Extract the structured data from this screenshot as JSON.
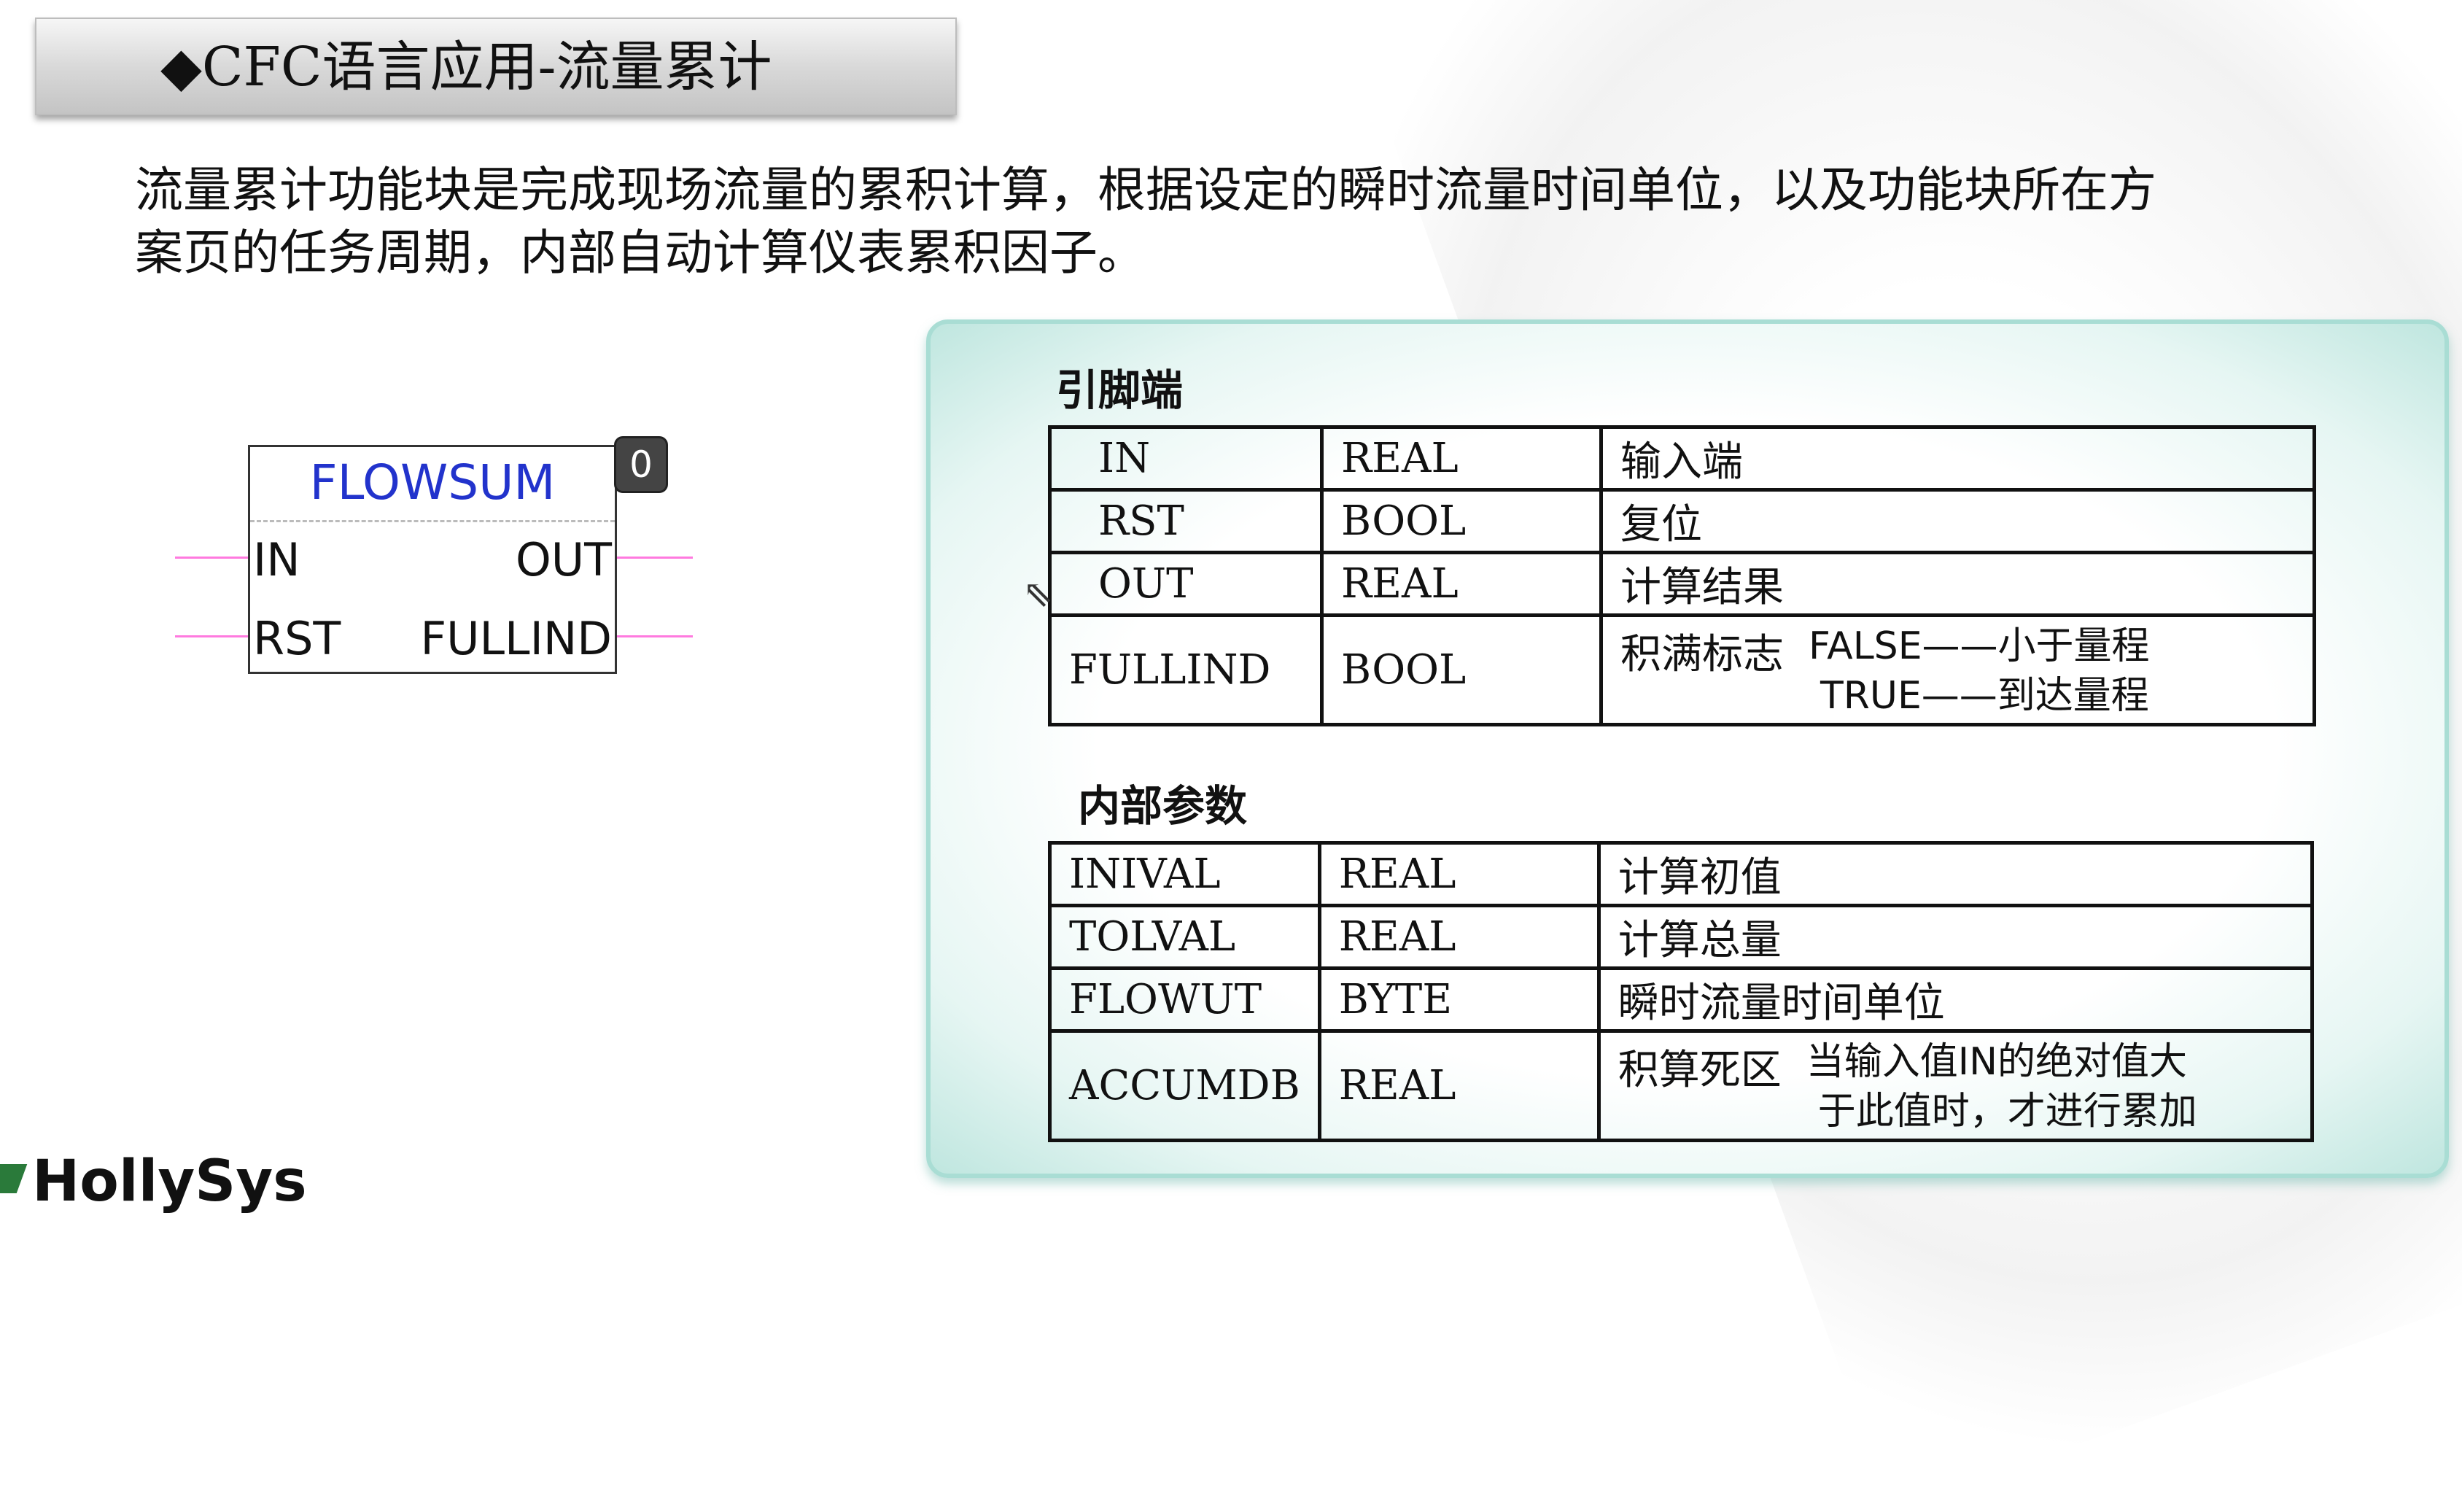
{
  "slide": {
    "title": "◆CFC语言应用-流量累计",
    "intro_line1": "流量累计功能块是完成现场流量的累积计算，根据设定的瞬时流量时间单位，以及功能块所在方",
    "intro_line2": "案页的任务周期，内部自动计算仪表累积因子。"
  },
  "function_block": {
    "name": "FLOWSUM",
    "badge": "0",
    "inputs": [
      "IN",
      "RST"
    ],
    "outputs": [
      "OUT",
      "FULLIND"
    ]
  },
  "pins_section": {
    "heading": "引脚端",
    "rows": [
      {
        "name": "IN",
        "type": "REAL",
        "desc": "输入端",
        "sub": []
      },
      {
        "name": "RST",
        "type": "BOOL",
        "desc": "复位",
        "sub": []
      },
      {
        "name": "OUT",
        "type": "REAL",
        "desc": "计算结果",
        "sub": []
      },
      {
        "name": "FULLIND",
        "type": "BOOL",
        "desc": "积满标志",
        "sub": [
          "FALSE——小于量程",
          "TRUE——到达量程"
        ]
      }
    ]
  },
  "params_section": {
    "heading": "内部参数",
    "rows": [
      {
        "name": "INIVAL",
        "type": "REAL",
        "desc": "计算初值",
        "sub": []
      },
      {
        "name": "TOLVAL",
        "type": "REAL",
        "desc": "计算总量",
        "sub": []
      },
      {
        "name": "FLOWUT",
        "type": "BYTE",
        "desc": "瞬时流量时间单位",
        "sub": []
      },
      {
        "name": "ACCUMDB",
        "type": "REAL",
        "desc": "积算死区",
        "sub": [
          "当输入值IN的绝对值大",
          "于此值时，才进行累加"
        ]
      }
    ]
  },
  "footer": {
    "logo_text": "HollySys"
  },
  "colors": {
    "block_name": "#2233cc",
    "pin_line": "#ff7adf",
    "panel_border": "#a9ddd4"
  }
}
